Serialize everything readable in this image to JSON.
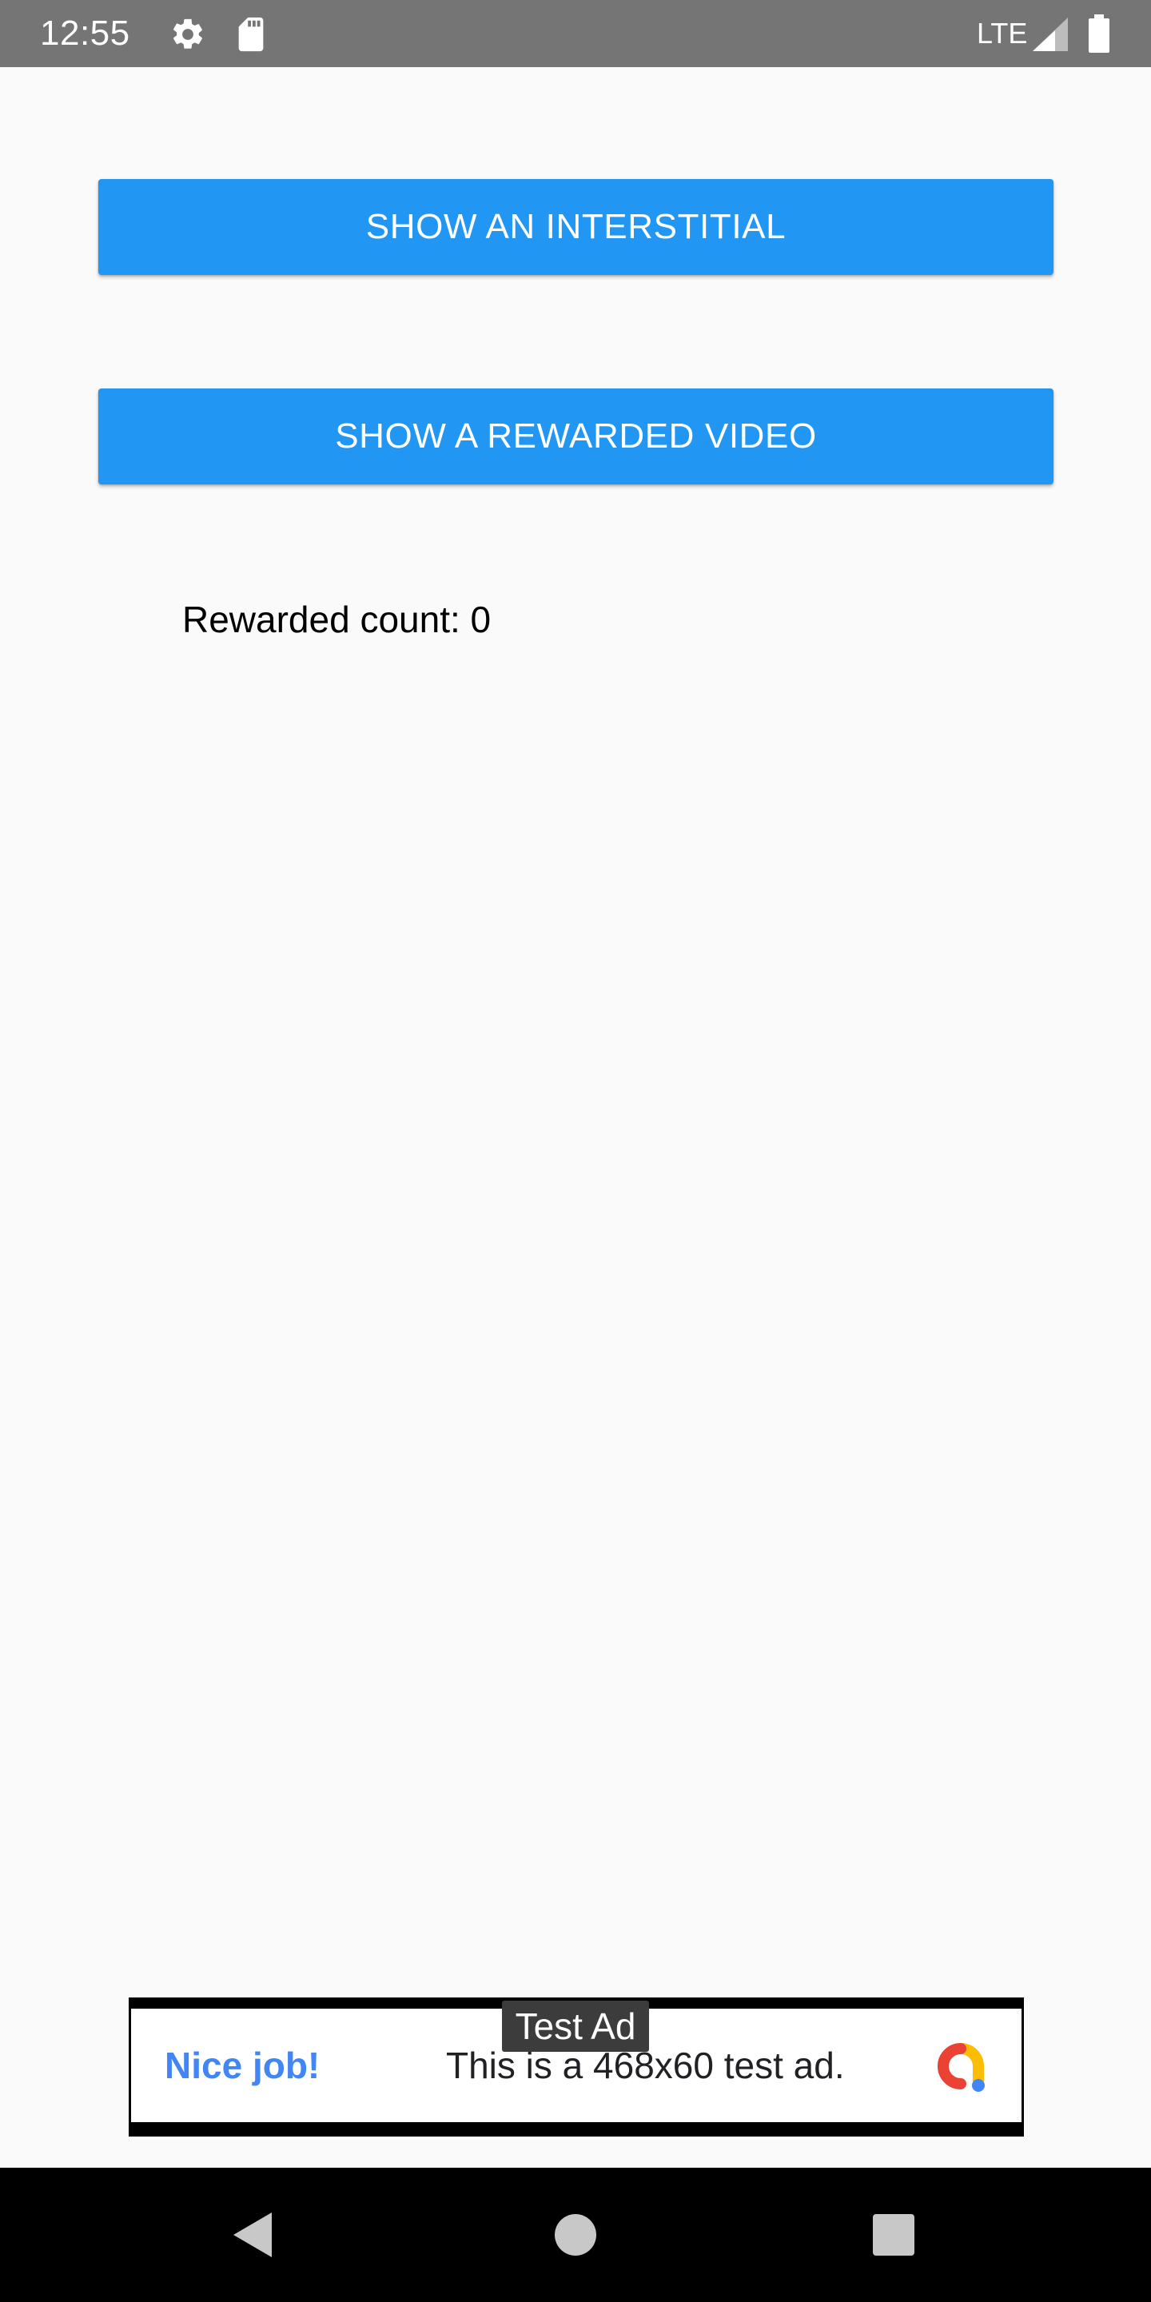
{
  "status_bar": {
    "time": "12:55",
    "network": "LTE",
    "icons": [
      "gear-icon",
      "sd-card-icon",
      "signal-icon",
      "battery-icon"
    ]
  },
  "main": {
    "interstitial_button": "SHOW AN INTERSTITIAL",
    "rewarded_button": "SHOW A REWARDED VIDEO",
    "rewarded_count": "Rewarded count: 0"
  },
  "ad": {
    "label": "Test Ad",
    "headline": "Nice job!",
    "body": "This is a 468x60 test ad.",
    "logo_icon": "admob-logo-icon"
  },
  "nav_bar": {
    "icons": [
      "back-icon",
      "home-icon",
      "recents-icon"
    ]
  },
  "colors": {
    "button_blue": "#2196f3",
    "status_bar": "#757575",
    "background": "#fafafa",
    "ad_headline": "#4285f4"
  }
}
